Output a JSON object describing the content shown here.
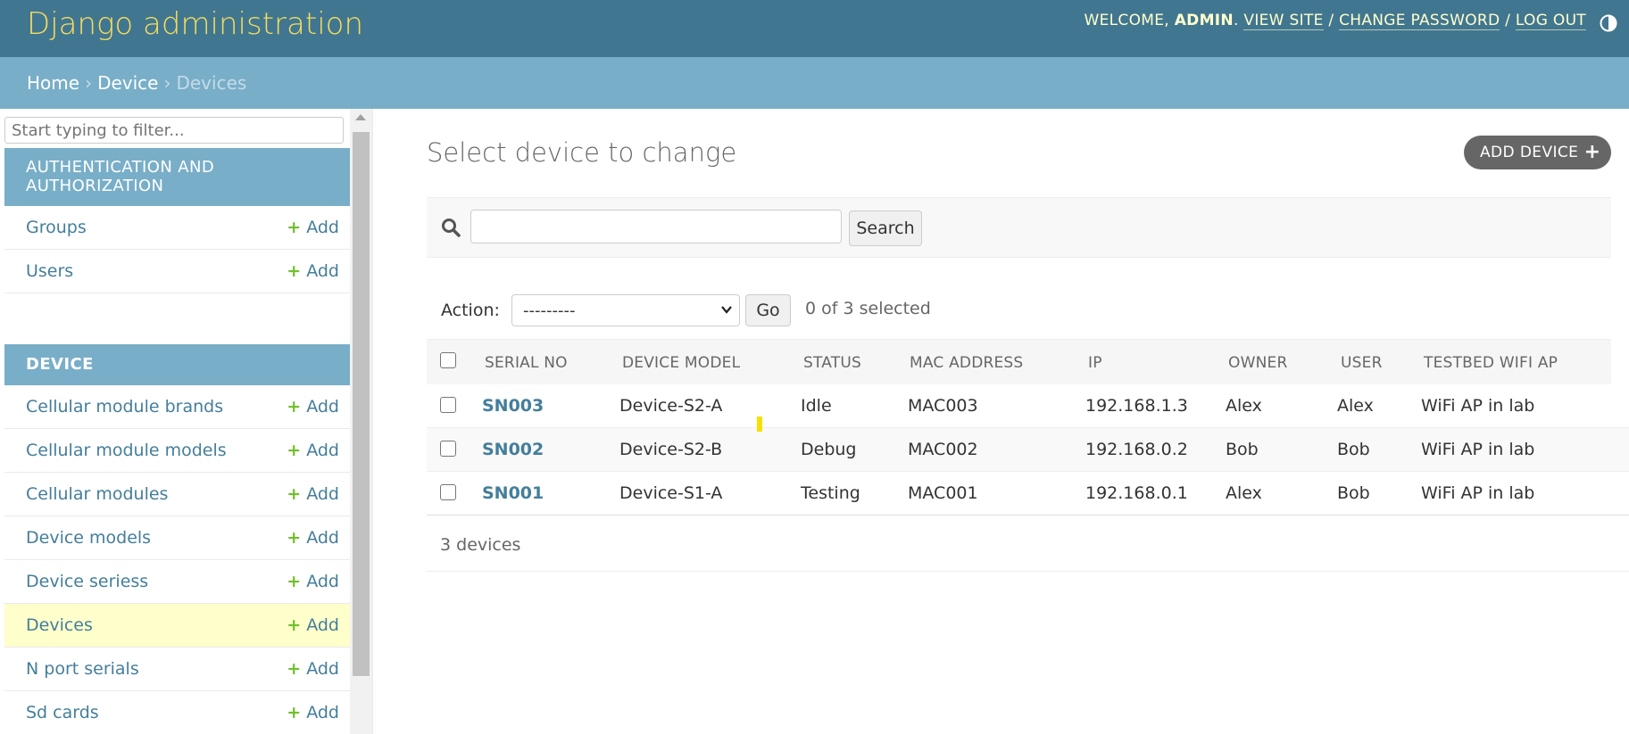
{
  "header": {
    "branding": "Django administration",
    "welcome": "WELCOME,",
    "username": "ADMIN",
    "view_site": "VIEW SITE",
    "change_password": "CHANGE PASSWORD",
    "log_out": "LOG OUT",
    "separator": "/",
    "theme_icon": "theme-toggle-icon"
  },
  "breadcrumbs": {
    "home": "Home",
    "app": "Device",
    "current": "Devices",
    "separator": "›"
  },
  "sidebar": {
    "filter_placeholder": "Start typing to filter...",
    "add_label": "Add",
    "auth_caption": "AUTHENTICATION AND AUTHORIZATION",
    "auth_items": [
      {
        "label": "Groups"
      },
      {
        "label": "Users"
      }
    ],
    "device_caption": "DEVICE",
    "device_items": [
      {
        "label": "Cellular module brands"
      },
      {
        "label": "Cellular module models"
      },
      {
        "label": "Cellular modules"
      },
      {
        "label": "Device models"
      },
      {
        "label": "Device seriess"
      },
      {
        "label": "Devices",
        "current": true
      },
      {
        "label": "N port serials"
      },
      {
        "label": "Sd cards"
      }
    ]
  },
  "content": {
    "title": "Select device to change",
    "add_button": "ADD DEVICE",
    "search_button": "Search",
    "search_value": "",
    "action_label": "Action:",
    "action_selected": "---------",
    "go_button": "Go",
    "selected_counter": "0 of 3 selected",
    "columns": [
      "SERIAL NO",
      "DEVICE MODEL",
      "STATUS",
      "MAC ADDRESS",
      "IP",
      "OWNER",
      "USER",
      "TESTBED WIFI AP"
    ],
    "rows": [
      {
        "serial": "SN003",
        "model": "Device-S2-A",
        "status": "Idle",
        "mac": "MAC003",
        "ip": "192.168.1.3",
        "owner": "Alex",
        "user": "Alex",
        "wifi": "WiFi AP in lab"
      },
      {
        "serial": "SN002",
        "model": "Device-S2-B",
        "status": "Debug",
        "mac": "MAC002",
        "ip": "192.168.0.2",
        "owner": "Bob",
        "user": "Bob",
        "wifi": "WiFi AP in lab"
      },
      {
        "serial": "SN001",
        "model": "Device-S1-A",
        "status": "Testing",
        "mac": "MAC001",
        "ip": "192.168.0.1",
        "owner": "Alex",
        "user": "Bob",
        "wifi": "WiFi AP in lab"
      }
    ],
    "paginator": "3 devices"
  },
  "colors": {
    "header_bg": "#417690",
    "branding": "#f5dd5d",
    "breadcrumbs_bg": "#79aec8",
    "link": "#447e9b",
    "add_plus": "#70bf2b",
    "current_row": "#ffffcc"
  }
}
